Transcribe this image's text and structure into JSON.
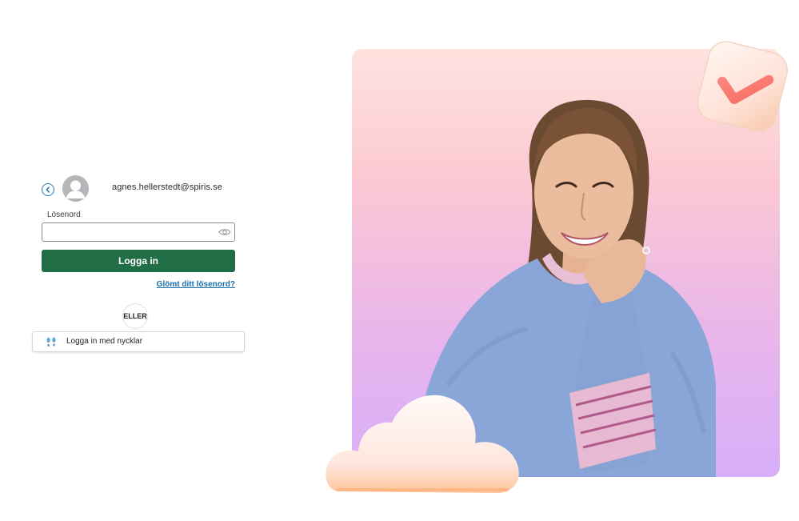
{
  "login": {
    "user_email": "agnes.hellerstedt@spiris.se",
    "password_label": "Lösenord",
    "password_value": "",
    "password_placeholder": "",
    "login_button_label": "Logga in",
    "forgot_password_link": "Glömt ditt lösenord?",
    "or_divider": "ELLER",
    "passkey_button_label": "Logga in med nycklar"
  },
  "icons": {
    "back": "chevron-left-circle-icon",
    "avatar": "user-avatar-icon",
    "show_password": "eye-icon",
    "passkey": "footprints-icon"
  },
  "colors": {
    "primary_button": "#216e46",
    "link": "#1a6fb0",
    "back_icon": "#1e78b4"
  }
}
